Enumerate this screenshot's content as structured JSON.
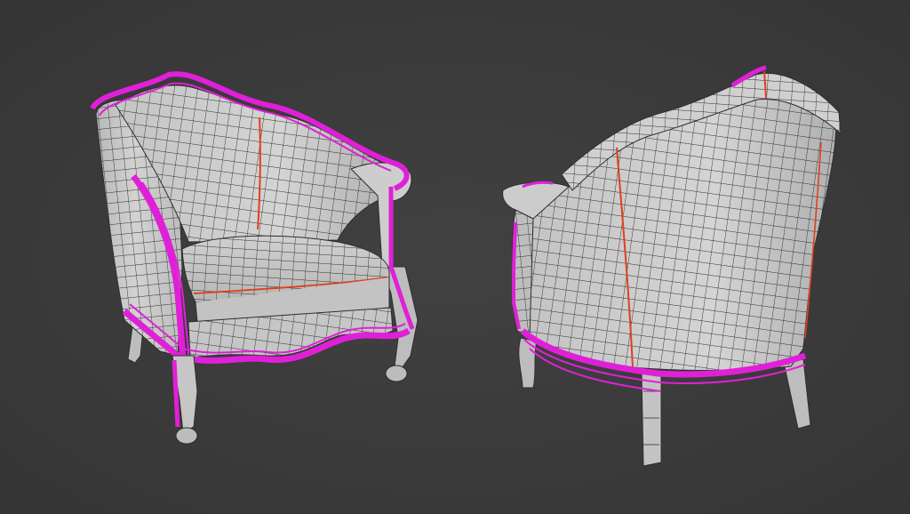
{
  "scene": {
    "background_color": "#3b3b3b",
    "mesh_color": "#c9c9c9",
    "wire_color": "#2e2e2e",
    "seam_color": "#e0401c",
    "selected_edge_color": "#e020d8",
    "objects": [
      {
        "name": "armchair",
        "view": "front-three-quarter"
      },
      {
        "name": "armchair",
        "view": "back-three-quarter"
      }
    ]
  }
}
